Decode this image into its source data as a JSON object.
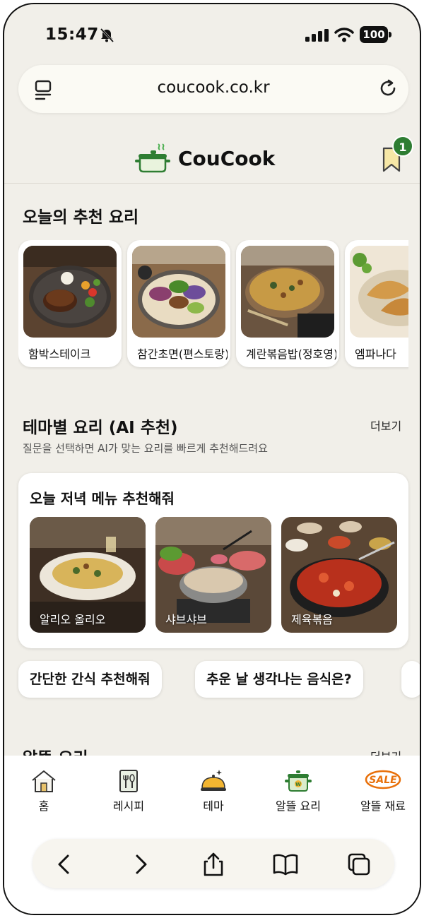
{
  "status": {
    "time": "15:47",
    "battery": "100"
  },
  "browser": {
    "url": "coucook.co.kr"
  },
  "header": {
    "brand": "CouCook",
    "bookmark_count": "1"
  },
  "recommended": {
    "title": "오늘의 추천 요리",
    "items": [
      {
        "label": "함박스테이크"
      },
      {
        "label": "참간초면(편스토랑)"
      },
      {
        "label": "계란볶음밥(정호영)"
      },
      {
        "label": "엠파나다"
      }
    ]
  },
  "theme": {
    "title": "테마별 요리 (AI 추천)",
    "more": "더보기",
    "subtitle": "질문을 선택하면 AI가 맞는 요리를 빠르게 추천해드려요",
    "question": "오늘 저녁 메뉴 추천해줘",
    "dishes": [
      {
        "label": "알리오 올리오"
      },
      {
        "label": "샤브샤브"
      },
      {
        "label": "제육볶음"
      }
    ],
    "chips": [
      {
        "label": "간단한 간식 추천해줘"
      },
      {
        "label": "추운 날 생각나는 음식은?"
      }
    ]
  },
  "thrifty": {
    "title": "알뜰 요리",
    "more": "더보기"
  },
  "tabs": [
    {
      "label": "홈",
      "icon": "home-icon"
    },
    {
      "label": "레시피",
      "icon": "recipe-icon"
    },
    {
      "label": "테마",
      "icon": "cloche-icon"
    },
    {
      "label": "알뜰 요리",
      "icon": "pot-icon"
    },
    {
      "label": "알뜰 재료",
      "icon": "sale-icon",
      "sale_text": "SALE"
    }
  ],
  "colors": {
    "accent": "#2e7d32",
    "sale": "#e8700a",
    "background": "#f1efe9"
  }
}
